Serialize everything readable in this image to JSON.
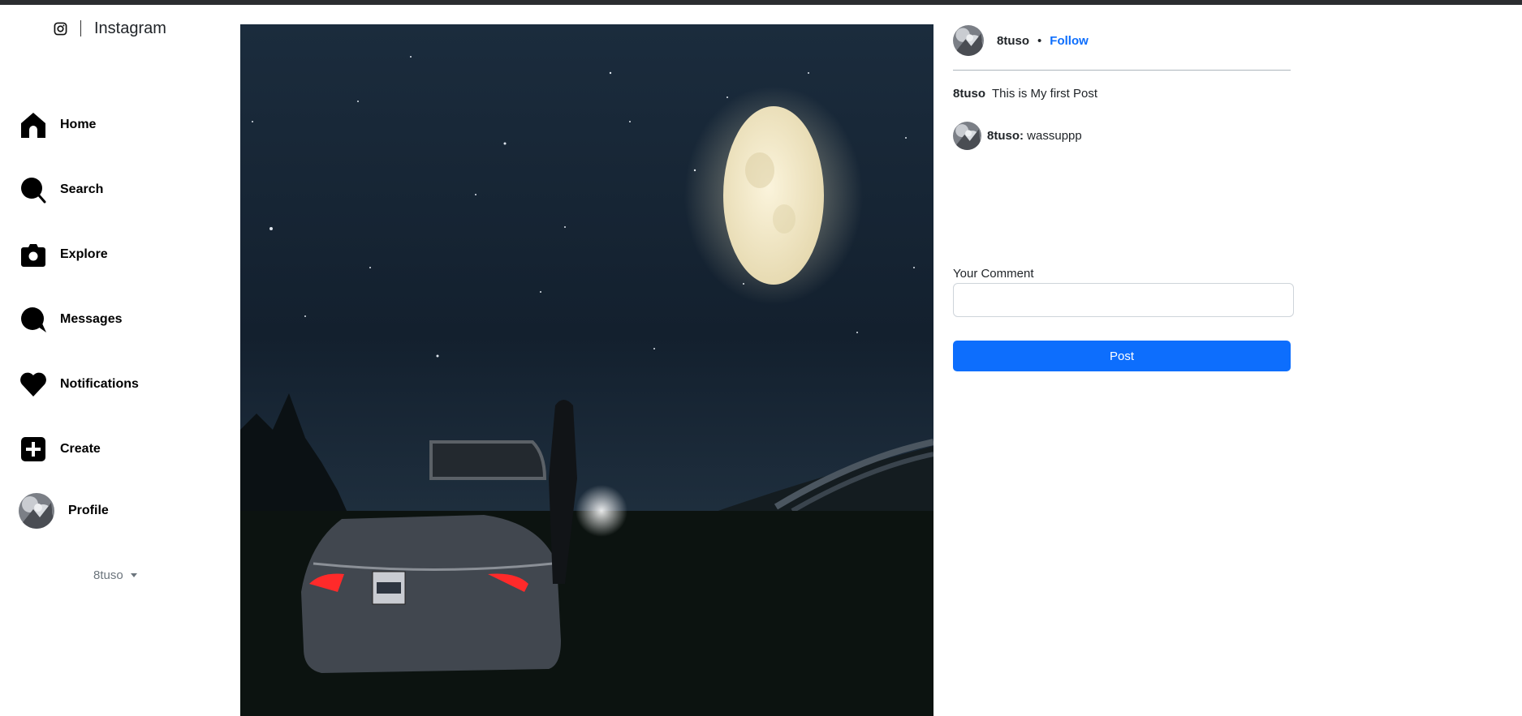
{
  "brand": {
    "name": "Instagram",
    "icon": "instagram-icon"
  },
  "sidebar": {
    "items": [
      {
        "label": "Home",
        "icon": "home-icon"
      },
      {
        "label": "Search",
        "icon": "search-icon"
      },
      {
        "label": "Explore",
        "icon": "camera-icon"
      },
      {
        "label": "Messages",
        "icon": "chat-bubble-icon"
      },
      {
        "label": "Notifications",
        "icon": "heart-icon"
      },
      {
        "label": "Create",
        "icon": "plus-square-icon"
      },
      {
        "label": "Profile",
        "icon": "avatar"
      }
    ],
    "user_menu": "8tuso"
  },
  "post": {
    "author": "8tuso",
    "separator": "•",
    "follow_label": "Follow",
    "caption_user": "8tuso",
    "caption_text": "This is My first Post",
    "comments": [
      {
        "user": "8tuso:",
        "text": "wassuppp"
      }
    ],
    "comment_label": "Your Comment",
    "comment_value": "",
    "post_button": "Post"
  },
  "colors": {
    "accent": "#0d6efd",
    "topbar": "#2b2d30"
  }
}
